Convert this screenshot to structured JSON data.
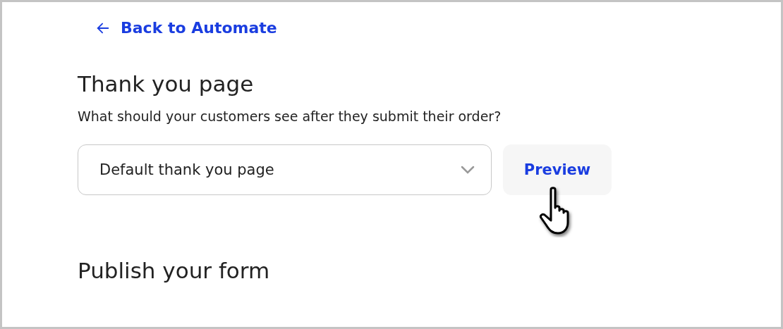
{
  "back_link": {
    "label": "Back to Automate"
  },
  "thank_you_section": {
    "title": "Thank you page",
    "description": "What should your customers see after they submit their order?"
  },
  "dropdown": {
    "value": "Default thank you page"
  },
  "preview_button": {
    "label": "Preview"
  },
  "publish_section": {
    "title": "Publish your form"
  }
}
